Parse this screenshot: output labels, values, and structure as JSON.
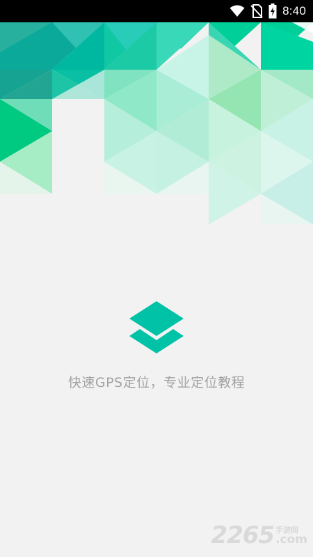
{
  "status_bar": {
    "time": "8:40",
    "icons": [
      "wifi-icon",
      "no-sim-icon",
      "battery-charging-icon"
    ]
  },
  "splash": {
    "tagline": "快速GPS定位，专业定位教程",
    "logo_icon": "layers-icon"
  },
  "watermark": {
    "number": "2265",
    "cn_text": "手游网",
    "domain": ".com"
  },
  "colors": {
    "background": "#f2f2f2",
    "brand_teal": "#00c2a6",
    "tagline_gray": "#a3a3a3"
  }
}
